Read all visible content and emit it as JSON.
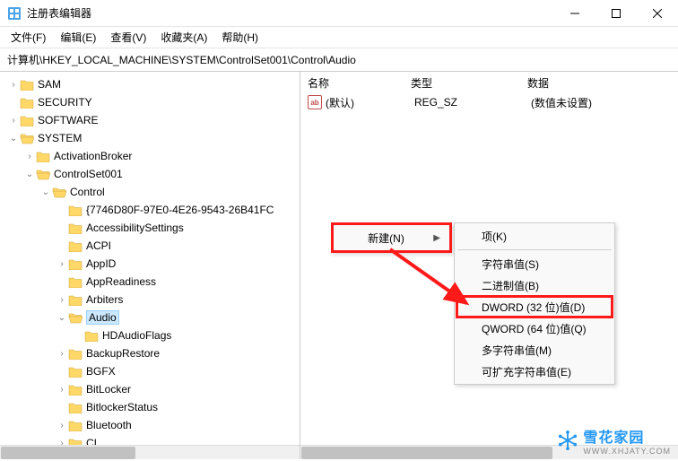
{
  "window": {
    "title": "注册表编辑器"
  },
  "menu": {
    "file": "文件(F)",
    "edit": "编辑(E)",
    "view": "查看(V)",
    "fav": "收藏夹(A)",
    "help": "帮助(H)"
  },
  "path": "计算机\\HKEY_LOCAL_MACHINE\\SYSTEM\\ControlSet001\\Control\\Audio",
  "tree": {
    "sam": "SAM",
    "security": "SECURITY",
    "software": "SOFTWARE",
    "system": "SYSTEM",
    "activationbroker": "ActivationBroker",
    "controlset001": "ControlSet001",
    "control": "Control",
    "guidkey": "{7746D80F-97E0-4E26-9543-26B41FC",
    "accessibility": "AccessibilitySettings",
    "acpi": "ACPI",
    "appid": "AppID",
    "appreadiness": "AppReadiness",
    "arbiters": "Arbiters",
    "audio": "Audio",
    "hdaudioflags": "HDAudioFlags",
    "backuprestore": "BackupRestore",
    "bgfx": "BGFX",
    "bitlocker": "BitLocker",
    "bitlockerstatus": "BitlockerStatus",
    "bluetooth": "Bluetooth",
    "ci": "CI"
  },
  "list": {
    "header": {
      "name": "名称",
      "type": "类型",
      "data": "数据"
    },
    "row0": {
      "name": "(默认)",
      "type": "REG_SZ",
      "data": "(数值未设置)"
    }
  },
  "ctx": {
    "new": "新建(N)",
    "key": "项(K)",
    "string": "字符串值(S)",
    "binary": "二进制值(B)",
    "dword": "DWORD (32 位)值(D)",
    "qword": "QWORD (64 位)值(Q)",
    "multi": "多字符串值(M)",
    "expand": "可扩充字符串值(E)"
  },
  "watermark": {
    "text": "雪花家园",
    "sub": "WWW.XHJATY.COM"
  }
}
